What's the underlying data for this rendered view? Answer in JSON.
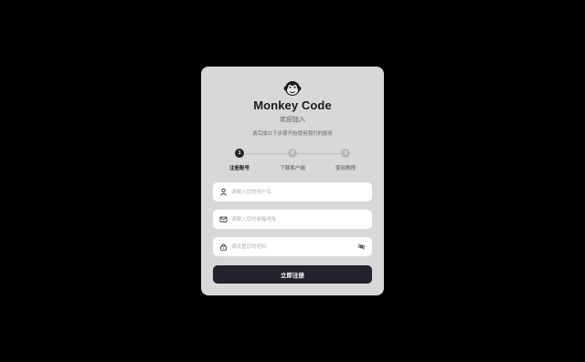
{
  "app": {
    "title": "Monkey Code",
    "subtitle": "欢迎加入",
    "description": "请完成以下步骤开始使用我们的服务",
    "logo_icon": "monkey-icon"
  },
  "steps": [
    {
      "number": "1",
      "label": "注册账号",
      "active": true
    },
    {
      "number": "2",
      "label": "下载客户端",
      "active": false
    },
    {
      "number": "3",
      "label": "使用教程",
      "active": false
    }
  ],
  "form": {
    "username": {
      "placeholder": "请输入您的用户名",
      "value": "",
      "icon": "user-icon"
    },
    "email": {
      "placeholder": "请输入您的邮箱地址",
      "value": "",
      "icon": "mail-icon"
    },
    "password": {
      "placeholder": "请设置您的密码",
      "value": "",
      "icon": "lock-icon",
      "toggle_icon": "eye-off-icon"
    },
    "submit_label": "立即注册"
  },
  "colors": {
    "background": "#000000",
    "card": "#d8d8d8",
    "primary": "#23232b"
  }
}
